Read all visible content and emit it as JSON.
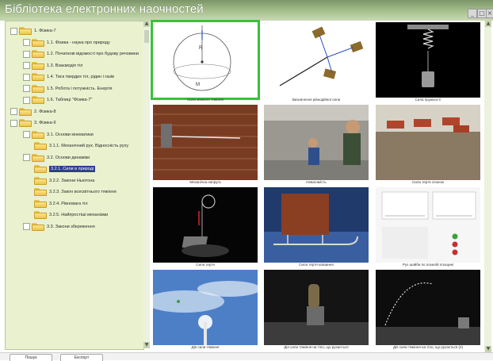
{
  "window": {
    "title": "Бібліотека електронних наочностей"
  },
  "tree": [
    {
      "label": "1. Фізика-7",
      "level": 0
    },
    {
      "label": "1.1. Фізика - наука про природу",
      "level": 1
    },
    {
      "label": "1.2. Початкові відомості про будову речовини",
      "level": 1
    },
    {
      "label": "1.3. Взаємодія тіл",
      "level": 1
    },
    {
      "label": "1.4. Тиск твердих тіл, рідин і газів",
      "level": 1
    },
    {
      "label": "1.5. Робота і потужність. Енергія",
      "level": 1
    },
    {
      "label": "1.6. Таблиці \"Фізика-7\"",
      "level": 1
    },
    {
      "label": "2. Фізика-8",
      "level": 0
    },
    {
      "label": "3. Фізика-9",
      "level": 0
    },
    {
      "label": "3.1. Основи кінематики",
      "level": 1
    },
    {
      "label": "3.1.1. Механічний рух. Відносність руху",
      "level": 2
    },
    {
      "label": "3.2. Основи динаміки",
      "level": 1
    },
    {
      "label": "3.2.1. Сили в природі",
      "level": 2,
      "selected": true
    },
    {
      "label": "3.2.2. Закони Ньютона",
      "level": 2
    },
    {
      "label": "3.2.3. Закон всесвітнього тяжіння",
      "level": 2
    },
    {
      "label": "3.2.4. Рівновага тіл",
      "level": 2
    },
    {
      "label": "3.2.5. Найпростіші механізми",
      "level": 2
    },
    {
      "label": "3.3. Закони збереження",
      "level": 1
    }
  ],
  "thumbnails": [
    {
      "caption": "Сила земного тяжіння",
      "scene": "sphere",
      "selected": true
    },
    {
      "caption": "Визначення рівнодійної сили",
      "scene": "vectors"
    },
    {
      "caption": "Сила пружності",
      "scene": "spring"
    },
    {
      "caption": "Механічна напруга",
      "scene": "wall"
    },
    {
      "caption": "Невагомість",
      "scene": "astronaut"
    },
    {
      "caption": "Сила тертя спокою",
      "scene": "bricks"
    },
    {
      "caption": "Сила тертя",
      "scene": "pulley"
    },
    {
      "caption": "Сила тертя ковзання",
      "scene": "sled"
    },
    {
      "caption": "Рух шайби по похилій площині",
      "scene": "graphs"
    },
    {
      "caption": "Дія сили тяжіння",
      "scene": "sky"
    },
    {
      "caption": "Дія сили тяжіння на тіло, що рухається",
      "scene": "cannon"
    },
    {
      "caption": "Дія сили тяжіння на тіло, що рухається (2)",
      "scene": "trajectory"
    }
  ],
  "window_buttons": [
    "_",
    "□",
    "×"
  ],
  "scroll_arrows": {
    "up": "▲",
    "down": "▼"
  },
  "tabs": [
    {
      "label": "Пошук"
    },
    {
      "label": "Експорт"
    }
  ]
}
